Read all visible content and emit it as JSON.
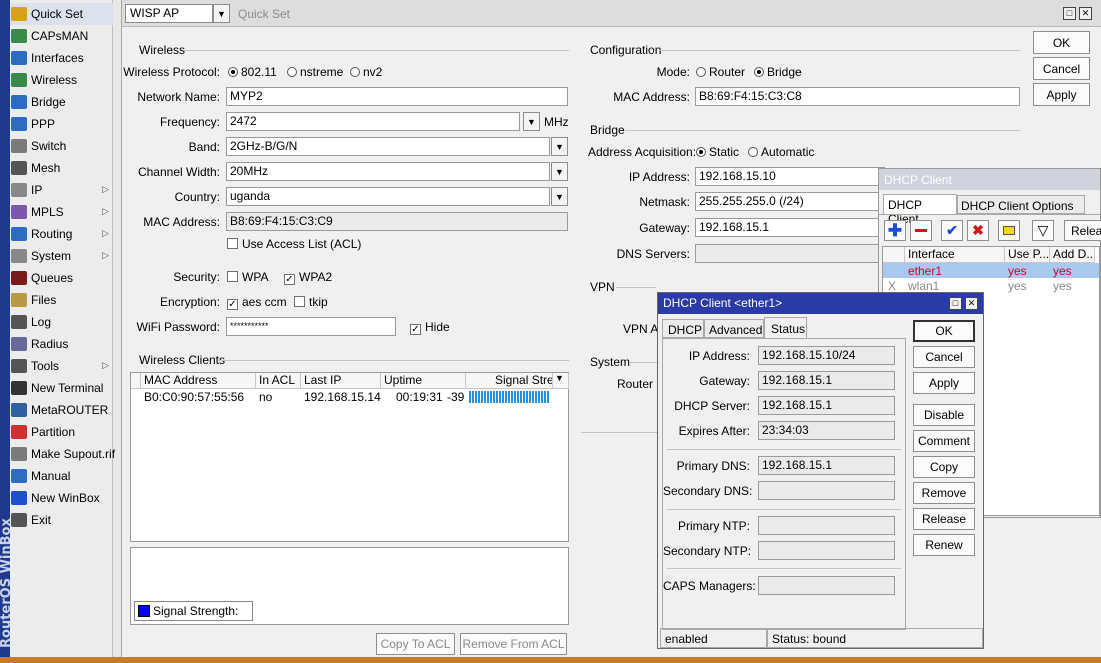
{
  "brand": "RouterOS WinBox",
  "sidebar": {
    "items": [
      {
        "label": "Quick Set",
        "icon": "quickset-icon"
      },
      {
        "label": "CAPsMAN",
        "icon": "capsman-icon"
      },
      {
        "label": "Interfaces",
        "icon": "interfaces-icon"
      },
      {
        "label": "Wireless",
        "icon": "wireless-icon"
      },
      {
        "label": "Bridge",
        "icon": "bridge-icon"
      },
      {
        "label": "PPP",
        "icon": "ppp-icon"
      },
      {
        "label": "Switch",
        "icon": "switch-icon"
      },
      {
        "label": "Mesh",
        "icon": "mesh-icon"
      },
      {
        "label": "IP",
        "icon": "ip-icon",
        "submenu": true
      },
      {
        "label": "MPLS",
        "icon": "mpls-icon",
        "submenu": true
      },
      {
        "label": "Routing",
        "icon": "routing-icon",
        "submenu": true
      },
      {
        "label": "System",
        "icon": "system-icon",
        "submenu": true
      },
      {
        "label": "Queues",
        "icon": "queues-icon"
      },
      {
        "label": "Files",
        "icon": "files-icon"
      },
      {
        "label": "Log",
        "icon": "log-icon"
      },
      {
        "label": "Radius",
        "icon": "radius-icon"
      },
      {
        "label": "Tools",
        "icon": "tools-icon",
        "submenu": true
      },
      {
        "label": "New Terminal",
        "icon": "terminal-icon"
      },
      {
        "label": "MetaROUTER",
        "icon": "metarouter-icon"
      },
      {
        "label": "Partition",
        "icon": "partition-icon"
      },
      {
        "label": "Make Supout.rif",
        "icon": "supout-icon"
      },
      {
        "label": "Manual",
        "icon": "manual-icon"
      },
      {
        "label": "New WinBox",
        "icon": "winbox-icon"
      },
      {
        "label": "Exit",
        "icon": "exit-icon"
      }
    ]
  },
  "quickset": {
    "mode": "WISP AP",
    "title": "Quick Set",
    "buttons": {
      "ok": "OK",
      "cancel": "Cancel",
      "apply": "Apply"
    },
    "wireless": {
      "section": "Wireless",
      "protocol_label": "Wireless Protocol:",
      "protocols": [
        "802.11",
        "nstreme",
        "nv2"
      ],
      "network_name_label": "Network Name:",
      "network_name": "MYP2",
      "frequency_label": "Frequency:",
      "frequency": "2472",
      "frequency_unit": "MHz",
      "band_label": "Band:",
      "band": "2GHz-B/G/N",
      "channel_width_label": "Channel Width:",
      "channel_width": "20MHz",
      "country_label": "Country:",
      "country": "uganda",
      "mac_label": "MAC Address:",
      "mac": "B8:69:F4:15:C3:C9",
      "acl_label": "Use Access List (ACL)",
      "security_label": "Security:",
      "wpa": "WPA",
      "wpa2": "WPA2",
      "encryption_label": "Encryption:",
      "aes": "aes ccm",
      "tkip": "tkip",
      "password_label": "WiFi Password:",
      "password": "***********",
      "hide_label": "Hide"
    },
    "clients": {
      "section": "Wireless Clients",
      "columns": [
        "MAC Address",
        "In ACL",
        "Last IP",
        "Uptime",
        "Signal Strength"
      ],
      "rows": [
        {
          "mac": "B0:C0:90:57:55:56",
          "acl": "no",
          "ip": "192.168.15.14",
          "uptime": "00:19:31",
          "signal": "-39"
        }
      ],
      "graph_legend": "Signal Strength:",
      "copy_acl": "Copy To ACL",
      "remove_acl": "Remove From ACL"
    },
    "configuration": {
      "section": "Configuration",
      "mode_label": "Mode:",
      "router": "Router",
      "bridge": "Bridge",
      "mac_label": "MAC Address:",
      "mac": "B8:69:F4:15:C3:C8"
    },
    "bridge": {
      "section": "Bridge",
      "acq_label": "Address Acquisition:",
      "static": "Static",
      "automatic": "Automatic",
      "ip_label": "IP Address:",
      "ip": "192.168.15.10",
      "netmask_label": "Netmask:",
      "netmask": "255.255.255.0 (/24)",
      "gateway_label": "Gateway:",
      "gateway": "192.168.15.1",
      "dns_label": "DNS Servers:"
    },
    "vpn": {
      "section": "VPN",
      "addr_label": "VPN Ad"
    },
    "system": {
      "section": "System",
      "router_label": "Router Id"
    }
  },
  "dhcp_list": {
    "title": "DHCP Client",
    "tabs": [
      "DHCP Client",
      "DHCP Client Options"
    ],
    "release": "Relea",
    "columns": [
      "Interface",
      "Use P...",
      "Add D..."
    ],
    "rows": [
      {
        "flag": "",
        "iface": "ether1",
        "use": "yes",
        "add": "yes"
      },
      {
        "flag": "X",
        "iface": "wlan1",
        "use": "yes",
        "add": "yes"
      }
    ]
  },
  "dhcp_dialog": {
    "title": "DHCP Client <ether1>",
    "tabs": [
      "DHCP",
      "Advanced",
      "Status"
    ],
    "ip_label": "IP Address:",
    "ip": "192.168.15.10/24",
    "gw_label": "Gateway:",
    "gw": "192.168.15.1",
    "server_label": "DHCP Server:",
    "server": "192.168.15.1",
    "expires_label": "Expires After:",
    "expires": "23:34:03",
    "pdns_label": "Primary DNS:",
    "pdns": "192.168.15.1",
    "sdns_label": "Secondary DNS:",
    "pntp_label": "Primary NTP:",
    "sntp_label": "Secondary NTP:",
    "caps_label": "CAPS Managers:",
    "buttons": [
      "OK",
      "Cancel",
      "Apply",
      "Disable",
      "Comment",
      "Copy",
      "Remove",
      "Release",
      "Renew"
    ],
    "status_left": "enabled",
    "status_right": "Status: bound"
  },
  "colors": {
    "accent": "#2b3ba6",
    "signal": "#2a8fd8",
    "legend": "#0000ff",
    "red_text": "#d4002a"
  }
}
